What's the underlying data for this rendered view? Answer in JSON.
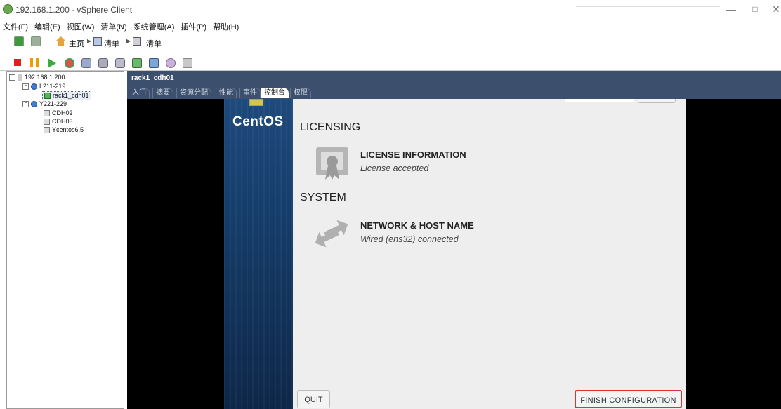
{
  "window": {
    "title": "192.168.1.200 - vSphere Client",
    "minimize": "—",
    "restore": "□",
    "close": "✕"
  },
  "menu": [
    "文件(F)",
    "编辑(E)",
    "视图(W)",
    "清单(N)",
    "系统管理(A)",
    "插件(P)",
    "帮助(H)"
  ],
  "nav": {
    "home": "主页",
    "inventory1": "清单",
    "inventory2": "清单"
  },
  "tree": {
    "root": "192.168.1.200",
    "groups": [
      {
        "label": "L211-219",
        "vms": [
          "rack1_cdh01"
        ]
      },
      {
        "label": "Y221-229",
        "vms": [
          "CDH02",
          "CDH03",
          "Ycentos6.5"
        ]
      }
    ],
    "selected": "rack1_cdh01"
  },
  "vm": {
    "name": "rack1_cdh01",
    "tabs": [
      "入门",
      "摘要",
      "资源分配",
      "性能",
      "事件",
      "控制台",
      "权限"
    ],
    "active_tab": "控制台"
  },
  "installer": {
    "logo": "CentOS",
    "sections": [
      {
        "title": "LICENSING",
        "items": [
          {
            "icon": "license-icon",
            "title": "LICENSE INFORMATION",
            "status": "License accepted"
          }
        ]
      },
      {
        "title": "SYSTEM",
        "items": [
          {
            "icon": "network-arrows-icon",
            "title": "NETWORK & HOST NAME",
            "status": "Wired (ens32) connected"
          }
        ]
      }
    ],
    "quit_label": "QUIT",
    "finish_label": "FINISH CONFIGURATION"
  },
  "colors": {
    "vm_header": "#3c4f6c",
    "highlight_border": "#dd3333",
    "installer_bg": "#eeeeee"
  }
}
